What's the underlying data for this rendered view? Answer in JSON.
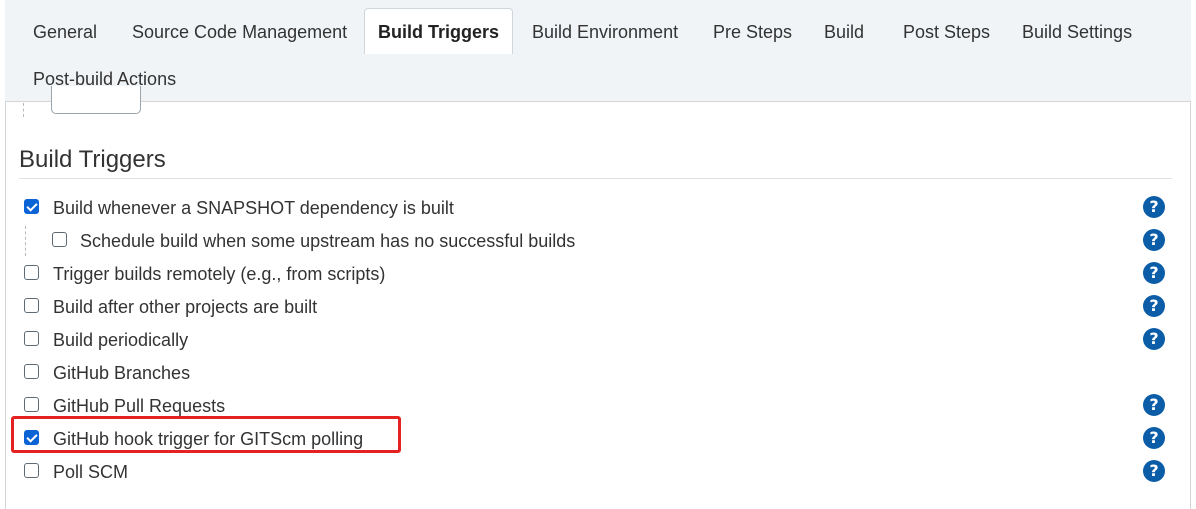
{
  "tabs": [
    {
      "label": "General",
      "active": false
    },
    {
      "label": "Source Code Management",
      "active": false
    },
    {
      "label": "Build Triggers",
      "active": true
    },
    {
      "label": "Build Environment",
      "active": false
    },
    {
      "label": "Pre Steps",
      "active": false
    },
    {
      "label": "Build",
      "active": false
    },
    {
      "label": "Post Steps",
      "active": false
    },
    {
      "label": "Build Settings",
      "active": false
    },
    {
      "label": "Post-build Actions",
      "active": false
    }
  ],
  "section": {
    "title": "Build Triggers",
    "options": [
      {
        "label": "Build whenever a SNAPSHOT dependency is built",
        "checked": true,
        "help": true,
        "help_icon": "question-mark-icon"
      },
      {
        "label": "Schedule build when some upstream has no successful builds",
        "checked": false,
        "help": true,
        "help_icon": "question-mark-icon"
      },
      {
        "label": "Trigger builds remotely (e.g., from scripts)",
        "checked": false,
        "help": true,
        "help_icon": "question-mark-icon"
      },
      {
        "label": "Build after other projects are built",
        "checked": false,
        "help": true,
        "help_icon": "question-mark-icon"
      },
      {
        "label": "Build periodically",
        "checked": false,
        "help": true,
        "help_icon": "question-mark-icon"
      },
      {
        "label": "GitHub Branches",
        "checked": false,
        "help": false
      },
      {
        "label": "GitHub Pull Requests",
        "checked": false,
        "help": true,
        "help_icon": "question-mark-icon"
      },
      {
        "label": "GitHub hook trigger for GITScm polling",
        "checked": true,
        "help": true,
        "help_icon": "question-mark-icon",
        "highlighted": true
      },
      {
        "label": "Poll SCM",
        "checked": false,
        "help": true,
        "help_icon": "question-mark-icon"
      }
    ]
  },
  "help_glyph": "?",
  "colors": {
    "accent": "#0b63d6",
    "help_icon_bg": "#0b5da8",
    "highlight": "#e52222",
    "tabbar_bg": "#f1f4f6"
  }
}
